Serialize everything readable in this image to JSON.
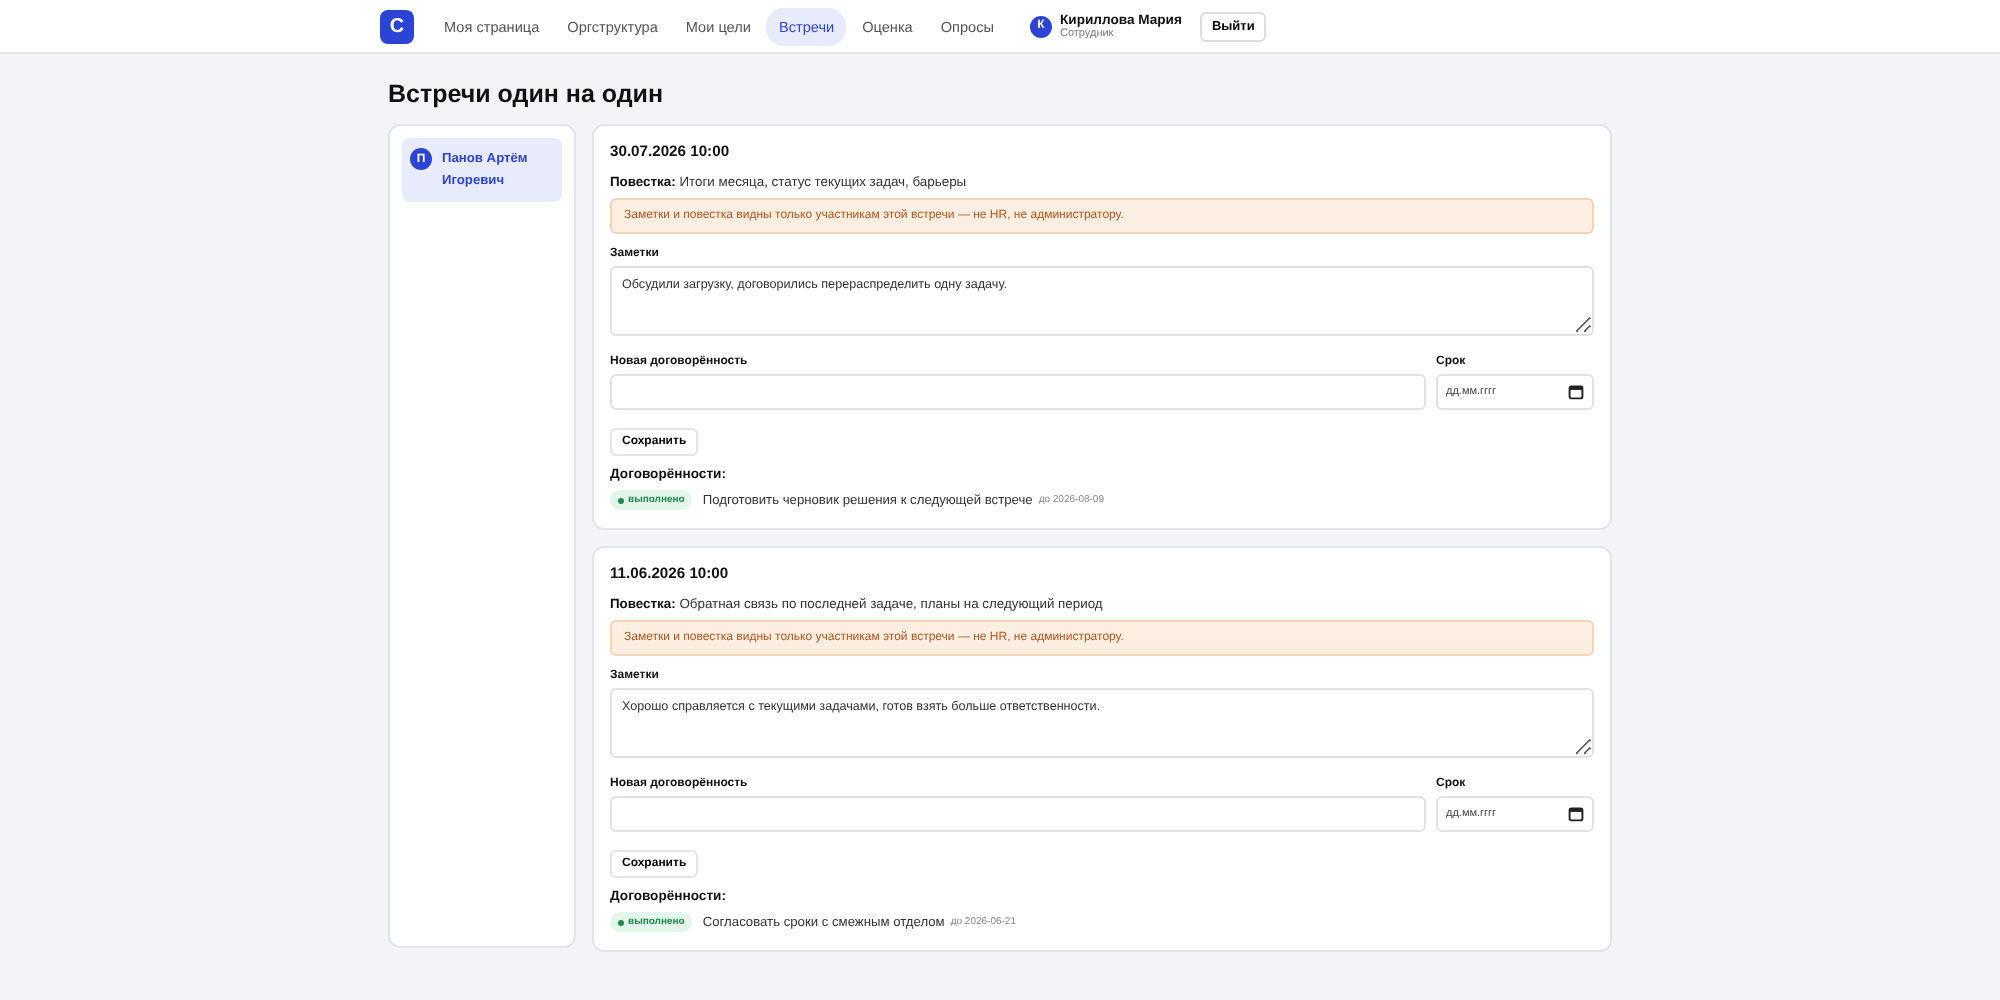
{
  "header": {
    "logo": "C",
    "nav": [
      {
        "label": "Моя страница",
        "selected": false
      },
      {
        "label": "Оргструктура",
        "selected": false
      },
      {
        "label": "Мои цели",
        "selected": false
      },
      {
        "label": "Встречи",
        "selected": true
      },
      {
        "label": "Оценка",
        "selected": false
      },
      {
        "label": "Опросы",
        "selected": false
      }
    ],
    "user": {
      "initial": "К",
      "name": "Кириллова Мария",
      "role": "Сотрудник"
    },
    "logout": "Выйти"
  },
  "title": "Встречи один на один",
  "people": [
    {
      "initial": "П",
      "name": "Панов Артём Игоревич",
      "selected": true
    }
  ],
  "meetings": [
    {
      "date": "30.07.2026 10:00",
      "agenda_label": "Повестка:",
      "agenda": "Итоги месяца, статус текущих задач, барьеры",
      "notice": "Заметки и повестка видны только участникам этой встречи — не HR, не администратору.",
      "notes_label": "Заметки",
      "notes": "Обсудили загрузку, договорились перераспределить одну задачу.",
      "new_label": "Новая договорённость",
      "due_label": "Срок",
      "due_placeholder": "дд.мм.гггг",
      "save": "Сохранить",
      "agreements_label": "Договорённости:",
      "agreements": [
        {
          "done": true,
          "badge": "выполнено",
          "text": "Подготовить черновик решения к следующей встрече",
          "due": "до 2026-08-09"
        }
      ]
    },
    {
      "date": "11.06.2026 10:00",
      "agenda_label": "Повестка:",
      "agenda": "Обратная связь по последней задаче, планы на следующий период",
      "notice": "Заметки и повестка видны только участникам этой встречи — не HR, не администратору.",
      "notes_label": "Заметки",
      "notes": "Хорошо справляется с текущими задачами, готов взять больше ответственности.",
      "new_label": "Новая договорённость",
      "due_label": "Срок",
      "due_placeholder": "дд.мм.гггг",
      "save": "Сохранить",
      "agreements_label": "Договорённости:",
      "agreements": [
        {
          "done": true,
          "badge": "выполнено",
          "text": "Согласовать сроки с смежным отделом",
          "due": "до 2026-06-21"
        }
      ]
    }
  ]
}
